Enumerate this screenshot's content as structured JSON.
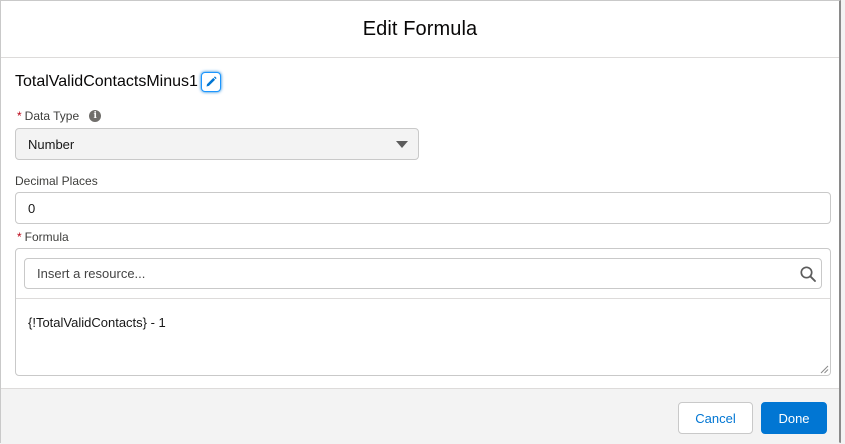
{
  "modal": {
    "title": "Edit Formula"
  },
  "resource": {
    "api_name": "TotalValidContactsMinus1",
    "edit_icon": "pencil-icon"
  },
  "data_type": {
    "required_marker": "*",
    "label": "Data Type",
    "info_icon": "info-icon",
    "info_glyph": "i",
    "selected": "Number"
  },
  "decimal_places": {
    "label": "Decimal Places",
    "value": "0"
  },
  "formula": {
    "required_marker": "*",
    "label": "Formula",
    "search_placeholder": "Insert a resource...",
    "search_icon": "search-icon",
    "expression": "{!TotalValidContacts} - 1"
  },
  "footer": {
    "cancel_label": "Cancel",
    "done_label": "Done"
  },
  "colors": {
    "brand": "#0176d3",
    "required": "#ba0517",
    "border": "#c9c9c9"
  }
}
